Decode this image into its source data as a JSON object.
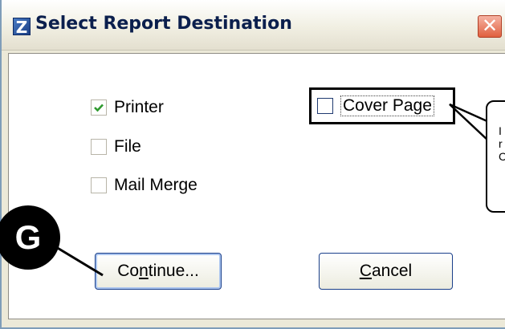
{
  "window": {
    "title": "Select Report Destination",
    "app_icon_glyph": "Z",
    "close_glyph": "✕"
  },
  "options": [
    {
      "label": "Printer",
      "checked": true
    },
    {
      "label": "File",
      "checked": false
    },
    {
      "label": "Mail Merge",
      "checked": false
    }
  ],
  "cover_page": {
    "label": "Cover Page",
    "checked": false
  },
  "buttons": {
    "continue": {
      "pre": "Co",
      "accel": "n",
      "post": "tinue..."
    },
    "cancel": {
      "pre": "",
      "accel": "C",
      "post": "ancel"
    }
  },
  "callout": {
    "letter": "G"
  },
  "note_lines": [
    "I",
    "r",
    "C"
  ],
  "colors": {
    "accent": "#1a3f8a",
    "check": "#2f9a2f",
    "close": "#e0603f"
  }
}
